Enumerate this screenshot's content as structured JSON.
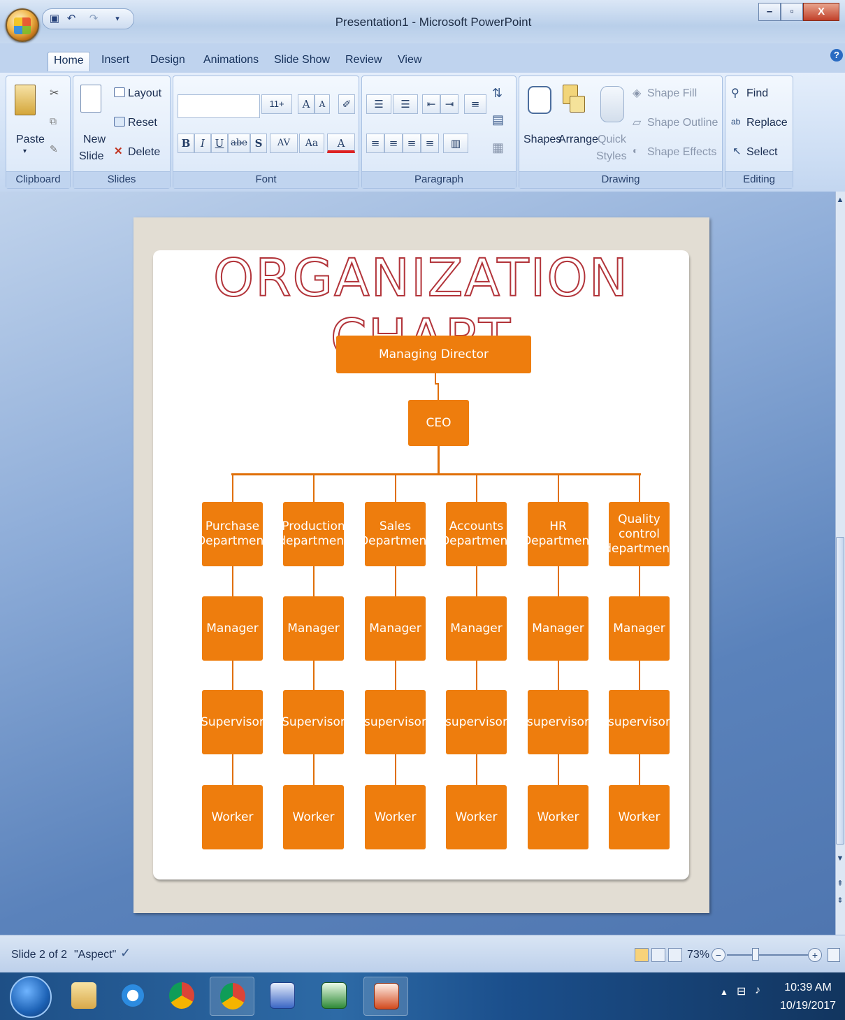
{
  "window": {
    "title": "Presentation1 - Microsoft PowerPoint",
    "min": "–",
    "max": "▫",
    "close": "X"
  },
  "tabs": [
    "Home",
    "Insert",
    "Design",
    "Animations",
    "Slide Show",
    "Review",
    "View"
  ],
  "ribbon": {
    "clipboard": {
      "label": "Clipboard",
      "paste": "Paste"
    },
    "slides": {
      "label": "Slides",
      "new_slide": "New",
      "new_slide2": "Slide",
      "layout": "Layout",
      "reset": "Reset",
      "delete": "Delete"
    },
    "font": {
      "label": "Font",
      "size": "11+",
      "bold": "B",
      "italic": "I",
      "underline": "U",
      "strike": "abe",
      "shadow": "S",
      "spacing": "AV",
      "case": "Aa",
      "color": "A"
    },
    "paragraph": {
      "label": "Paragraph"
    },
    "drawing": {
      "label": "Drawing",
      "shapes": "Shapes",
      "arrange": "Arrange",
      "quick": "Quick",
      "styles": "Styles",
      "fill": "Shape Fill",
      "outline": "Shape Outline",
      "effects": "Shape Effects"
    },
    "editing": {
      "label": "Editing",
      "find": "Find",
      "replace": "Replace",
      "select": "Select"
    }
  },
  "slide": {
    "title": "ORGANIZATION CHART",
    "md": "Managing Director",
    "ceo": "CEO",
    "departments": [
      {
        "name": "Purchase Department",
        "manager": "Manager",
        "supervisor": "Supervisor",
        "worker": "Worker"
      },
      {
        "name": "Production department",
        "manager": "Manager",
        "supervisor": "Supervisor",
        "worker": "Worker"
      },
      {
        "name": "Sales Department",
        "manager": "Manager",
        "supervisor": "supervisor",
        "worker": "Worker"
      },
      {
        "name": "Accounts Department",
        "manager": "Manager",
        "supervisor": "supervisor",
        "worker": "Worker"
      },
      {
        "name": "HR Department",
        "manager": "Manager",
        "supervisor": "supervisor",
        "worker": "Worker"
      },
      {
        "name": "Quality control department",
        "manager": "Manager",
        "supervisor": "supervisor",
        "worker": "Worker"
      }
    ]
  },
  "status": {
    "slide": "Slide 2 of 2",
    "theme": "\"Aspect\"",
    "zoom": "73%",
    "zoom_out": "−",
    "zoom_in": "+"
  },
  "taskbar": {
    "time": "10:39 AM",
    "date": "10/19/2017"
  },
  "colors": {
    "box": "#ee7d0d",
    "title_outline": "#b2343a"
  }
}
